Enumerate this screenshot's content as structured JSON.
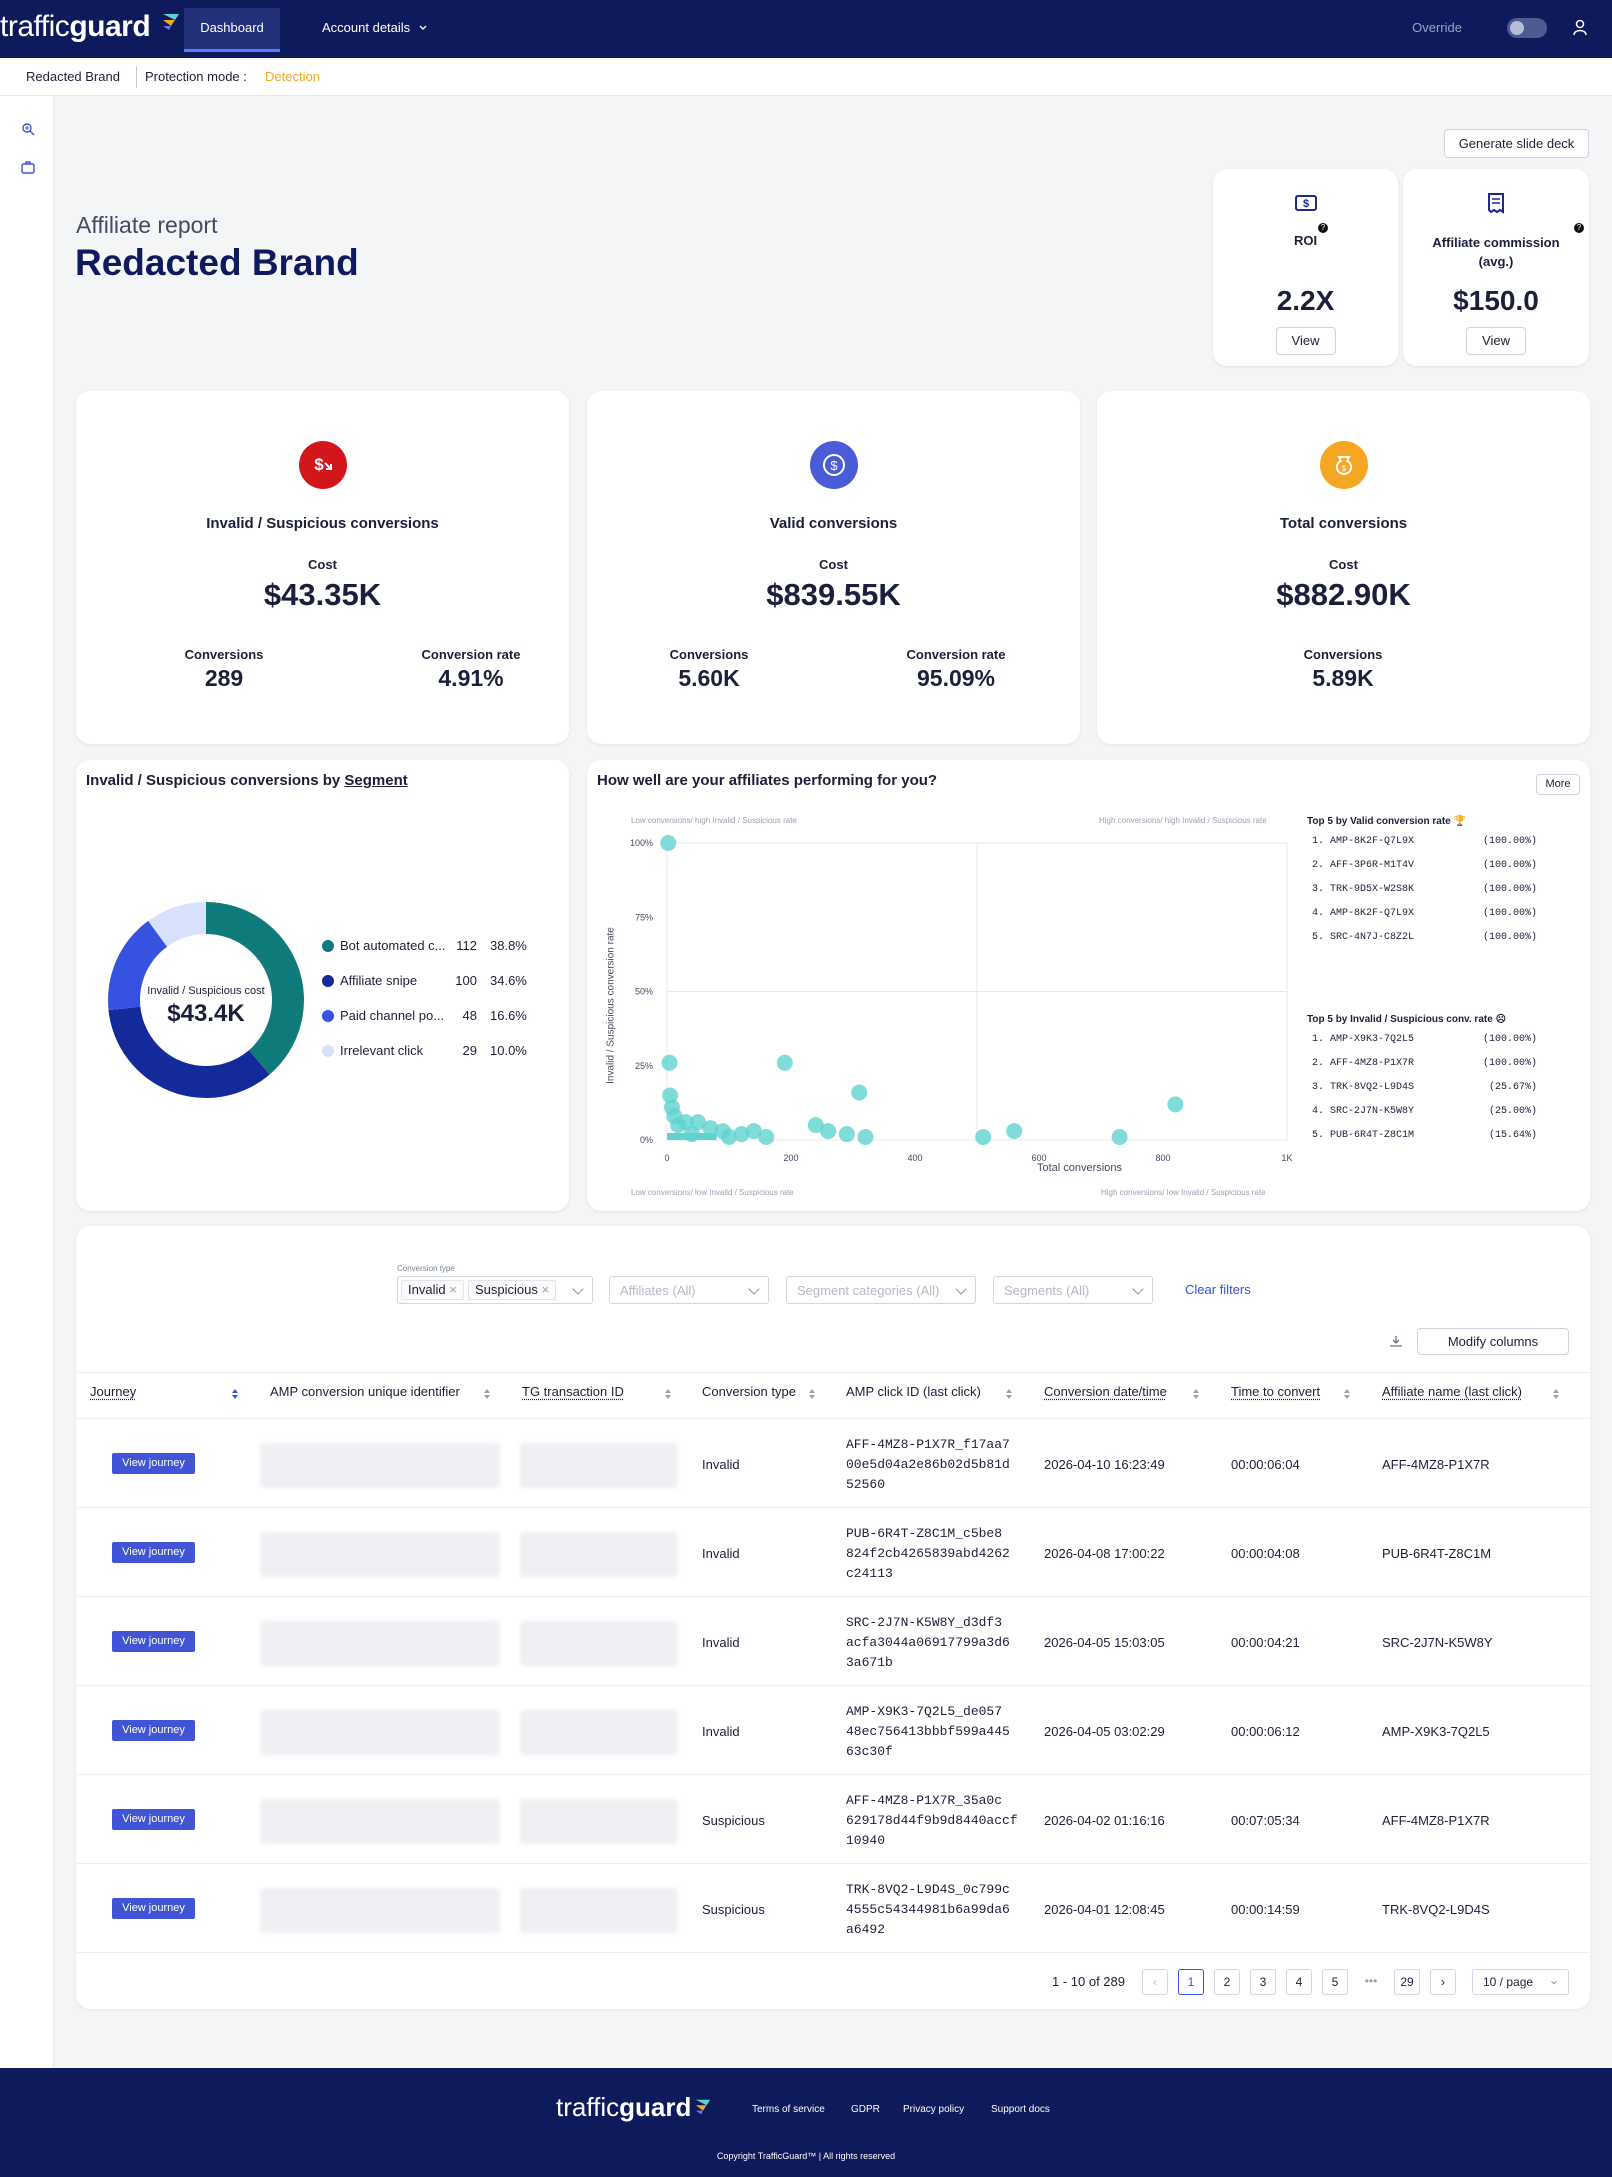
{
  "nav": {
    "logo_light": "traffic",
    "logo_bold": "guard",
    "tab_dashboard": "Dashboard",
    "tab_account": "Account details",
    "override_label": "Override",
    "icons": [
      "logo-mark-icon",
      "chevron-down-icon",
      "user-icon"
    ]
  },
  "subheader": {
    "brand": "Redacted Brand",
    "protection_label": "Protection mode :",
    "protection_value": "Detection",
    "protection_color": "#f5a623"
  },
  "header": {
    "subtitle": "Affiliate report",
    "title": "Redacted Brand",
    "slide_deck_button": "Generate slide deck"
  },
  "kpis": [
    {
      "label": "ROI",
      "value": "2.2X",
      "button": "View",
      "icon": "dollar-bill-icon"
    },
    {
      "label": "Affiliate commission (avg.)",
      "value": "$150.0",
      "button": "View",
      "icon": "receipt-icon"
    }
  ],
  "metrics": [
    {
      "title": "Invalid / Suspicious conversions",
      "cost_label": "Cost",
      "cost": "$43.35K",
      "stat1_label": "Conversions",
      "stat1": "289",
      "stat2_label": "Conversion rate",
      "stat2": "4.91%",
      "color": "#d3161c"
    },
    {
      "title": "Valid conversions",
      "cost_label": "Cost",
      "cost": "$839.55K",
      "stat1_label": "Conversions",
      "stat1": "5.60K",
      "stat2_label": "Conversion rate",
      "stat2": "95.09%",
      "color": "#4a5cd8"
    },
    {
      "title": "Total conversions",
      "cost_label": "Cost",
      "cost": "$882.90K",
      "stat1_label": "Conversions",
      "stat1": "5.89K",
      "color": "#f5a623"
    }
  ],
  "segment_chart": {
    "title_prefix": "Invalid / Suspicious conversions by",
    "title_link": "Segment",
    "center_label": "Invalid / Suspicious cost",
    "center_value": "$43.4K",
    "segments": [
      {
        "name": "Bot automated c...",
        "count": "112",
        "pct": "38.8%",
        "color": "#0f7a7a"
      },
      {
        "name": "Affiliate snipe",
        "count": "100",
        "pct": "34.6%",
        "color": "#142a9b"
      },
      {
        "name": "Paid channel po...",
        "count": "48",
        "pct": "16.6%",
        "color": "#3553e0"
      },
      {
        "name": "Irrelevant click",
        "count": "29",
        "pct": "10.0%",
        "color": "#d7e1fb"
      }
    ]
  },
  "chart_data": {
    "type": "scatter",
    "title": "How well are your affiliates performing for you?",
    "xlabel": "Total conversions",
    "ylabel": "Invalid / Suspicious conversion rate",
    "xlim": [
      0,
      1000
    ],
    "ylim": [
      0,
      100
    ],
    "xticks": [
      "0",
      "200",
      "400",
      "600",
      "800",
      "1K"
    ],
    "yticks": [
      "0%",
      "25%",
      "50%",
      "75%",
      "100%"
    ],
    "quadrant_labels": {
      "top_left": "Low conversions/ high Invalid / Suspicious rate",
      "top_right": "High conversions/ high Invalid / Suspicious rate",
      "bottom_left": "Low conversions/ low Invalid / Suspicious rate",
      "bottom_right": "High conversions/ low Invalid / Suspicious rate"
    },
    "color": "#5fd3cf",
    "points": [
      {
        "x": 2,
        "y": 100
      },
      {
        "x": 4,
        "y": 26
      },
      {
        "x": 190,
        "y": 26
      },
      {
        "x": 310,
        "y": 16
      },
      {
        "x": 5,
        "y": 15
      },
      {
        "x": 8,
        "y": 11
      },
      {
        "x": 12,
        "y": 8
      },
      {
        "x": 18,
        "y": 5
      },
      {
        "x": 30,
        "y": 6
      },
      {
        "x": 50,
        "y": 6
      },
      {
        "x": 70,
        "y": 4
      },
      {
        "x": 90,
        "y": 3
      },
      {
        "x": 120,
        "y": 2
      },
      {
        "x": 140,
        "y": 3
      },
      {
        "x": 160,
        "y": 1
      },
      {
        "x": 240,
        "y": 5
      },
      {
        "x": 260,
        "y": 3
      },
      {
        "x": 290,
        "y": 2
      },
      {
        "x": 320,
        "y": 1
      },
      {
        "x": 510,
        "y": 1
      },
      {
        "x": 560,
        "y": 3
      },
      {
        "x": 730,
        "y": 1
      },
      {
        "x": 820,
        "y": 12
      },
      {
        "x": 40,
        "y": 2
      },
      {
        "x": 100,
        "y": 1
      }
    ]
  },
  "scatter_panel": {
    "more_button": "More",
    "top_valid_title": "Top 5 by Valid conversion rate",
    "top_valid": [
      {
        "name": "1. AMP-8K2F-Q7L9X",
        "pct": "(100.00%)"
      },
      {
        "name": "2. AFF-3P6R-M1T4V",
        "pct": "(100.00%)"
      },
      {
        "name": "3. TRK-9D5X-W2S8K",
        "pct": "(100.00%)"
      },
      {
        "name": "4. AMP-8K2F-Q7L9X",
        "pct": "(100.00%)"
      },
      {
        "name": "5. SRC-4N7J-C8Z2L",
        "pct": "(100.00%)"
      }
    ],
    "top_invalid_title": "Top 5 by Invalid / Suspicious conv. rate",
    "top_invalid": [
      {
        "name": "1. AMP-X9K3-7Q2L5",
        "pct": "(100.00%)"
      },
      {
        "name": "2. AFF-4MZ8-P1X7R",
        "pct": "(100.00%)"
      },
      {
        "name": "3. TRK-8VQ2-L9D4S",
        "pct": "(25.67%)"
      },
      {
        "name": "4. SRC-2J7N-K5W8Y",
        "pct": "(25.00%)"
      },
      {
        "name": "5. PUB-6R4T-Z8C1M",
        "pct": "(15.64%)"
      }
    ]
  },
  "filters": {
    "conversion_type_label": "Conversion type",
    "tags": [
      "Invalid",
      "Suspicious"
    ],
    "affiliates": "Affiliates (All)",
    "segment_categories": "Segment categories (All)",
    "segments": "Segments (All)",
    "clear": "Clear filters",
    "modify_columns": "Modify columns"
  },
  "table": {
    "columns": [
      "Journey",
      "AMP conversion unique identifier",
      "TG transaction ID",
      "Conversion type",
      "AMP click ID (last click)",
      "Conversion date/time",
      "Time to convert",
      "Affiliate name (last click)"
    ],
    "view_journey": "View journey",
    "rows": [
      {
        "type": "Invalid",
        "click1": "AFF-4MZ8-P1X7R_f17aa7",
        "click2": "00e5d04a2e86b02d5b81d",
        "click3": "52560",
        "date": "2026-04-10 16:23:49",
        "ttc": "00:00:06:04",
        "affiliate": "AFF-4MZ8-P1X7R"
      },
      {
        "type": "Invalid",
        "click1": "PUB-6R4T-Z8C1M_c5be8",
        "click2": "824f2cb4265839abd4262",
        "click3": "c24113",
        "date": "2026-04-08 17:00:22",
        "ttc": "00:00:04:08",
        "affiliate": "PUB-6R4T-Z8C1M"
      },
      {
        "type": "Invalid",
        "click1": "SRC-2J7N-K5W8Y_d3df3",
        "click2": "acfa3044a06917799a3d6",
        "click3": "3a671b",
        "date": "2026-04-05 15:03:05",
        "ttc": "00:00:04:21",
        "affiliate": "SRC-2J7N-K5W8Y"
      },
      {
        "type": "Invalid",
        "click1": "AMP-X9K3-7Q2L5_de057",
        "click2": "48ec756413bbbf599a445",
        "click3": "63c30f",
        "date": "2026-04-05 03:02:29",
        "ttc": "00:00:06:12",
        "affiliate": "AMP-X9K3-7Q2L5"
      },
      {
        "type": "Suspicious",
        "click1": "AFF-4MZ8-P1X7R_35a0c",
        "click2": "629178d44f9b9d8440accf",
        "click3": "10940",
        "date": "2026-04-02 01:16:16",
        "ttc": "00:07:05:34",
        "affiliate": "AFF-4MZ8-P1X7R"
      },
      {
        "type": "Suspicious",
        "click1": "TRK-8VQ2-L9D4S_0c799c",
        "click2": "4555c54344981b6a99da6",
        "click3": "a6492",
        "date": "2026-04-01 12:08:45",
        "ttc": "00:00:14:59",
        "affiliate": "TRK-8VQ2-L9D4S"
      }
    ]
  },
  "pagination": {
    "summary": "1 - 10 of 289",
    "pages": [
      "1",
      "2",
      "3",
      "4",
      "5"
    ],
    "ellipsis": "•••",
    "last": "29",
    "per_page": "10 / page",
    "current": "1"
  },
  "footer": {
    "logo_light": "traffic",
    "logo_bold": "guard",
    "links": [
      "Terms of service",
      "GDPR",
      "Privacy policy",
      "Support docs"
    ],
    "copyright": "Copyright TrafficGuard™ | All rights reserved"
  }
}
